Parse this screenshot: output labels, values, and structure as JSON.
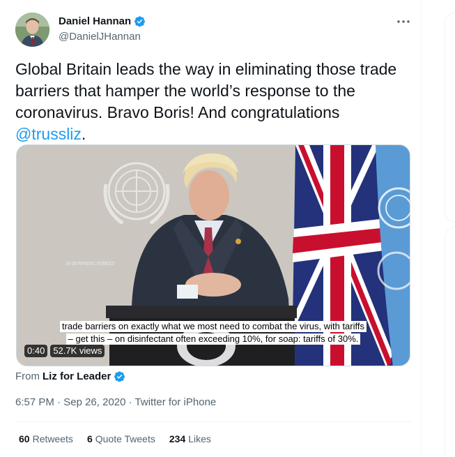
{
  "author": {
    "display_name": "Daniel Hannan",
    "handle": "@DanielJHannan"
  },
  "tweet": {
    "text_before": "Global Britain leads the way in eliminating those trade barriers that hamper the world’s response to the coronavirus. Bravo Boris! And congratulations ",
    "mention": "@trussliz",
    "text_after": "."
  },
  "media": {
    "caption_line1": "trade barriers on exactly what we most need to combat the virus, with tariffs",
    "caption_line2": "– get this – on disinfectant often exceeding 10%, for soap: tariffs of 30%.",
    "duration": "0:40",
    "views": "52.7K views",
    "lectern_text": "10 DOWNING STREET"
  },
  "source": {
    "prefix": "From",
    "name": "Liz for Leader"
  },
  "meta": {
    "time": "6:57 PM",
    "separator1": " · ",
    "date": "Sep 26, 2020",
    "separator2": " · ",
    "client": "Twitter for iPhone"
  },
  "stats": {
    "retweets_count": "60",
    "retweets_label": "Retweets",
    "quotes_count": "6",
    "quotes_label": "Quote Tweets",
    "likes_count": "234",
    "likes_label": "Likes"
  },
  "colors": {
    "accent": "#1d9bf0",
    "text_primary": "#0f1419",
    "text_secondary": "#536471"
  },
  "icons": {
    "verified": "verified-badge-icon",
    "more": "more-icon"
  }
}
